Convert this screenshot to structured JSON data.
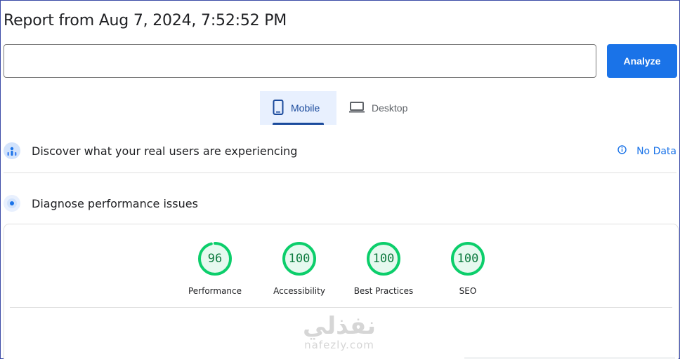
{
  "report": {
    "title": "Report from Aug 7, 2024, 7:52:52 PM"
  },
  "url_input": {
    "value": "",
    "placeholder": ""
  },
  "analyze_button": {
    "label": "Analyze"
  },
  "device_tabs": [
    {
      "label": "Mobile",
      "icon": "phone-icon",
      "selected": true
    },
    {
      "label": "Desktop",
      "icon": "laptop-icon",
      "selected": false
    }
  ],
  "sections": {
    "discover": {
      "label": "Discover what your real users are experiencing",
      "icon": "crux-users-icon",
      "status": "No Data",
      "status_icon": "info-icon"
    },
    "diagnose": {
      "label": "Diagnose performance issues",
      "icon": "lighthouse-icon"
    }
  },
  "scores": [
    {
      "value": "96",
      "label": "Performance"
    },
    {
      "value": "100",
      "label": "Accessibility"
    },
    {
      "value": "100",
      "label": "Best Practices"
    },
    {
      "value": "100",
      "label": "SEO"
    }
  ],
  "watermark": {
    "arabic": "نفذلي",
    "latin": "nafezly.com"
  },
  "colors": {
    "accent": "#1a73e8",
    "tab_selected_bg": "#e8f0fe",
    "tab_selected_text": "#1a4a9c",
    "score_pass": "#0cce6b",
    "score_pass_text": "#0c7a3e",
    "score_pass_bg": "#e6f9ef"
  }
}
